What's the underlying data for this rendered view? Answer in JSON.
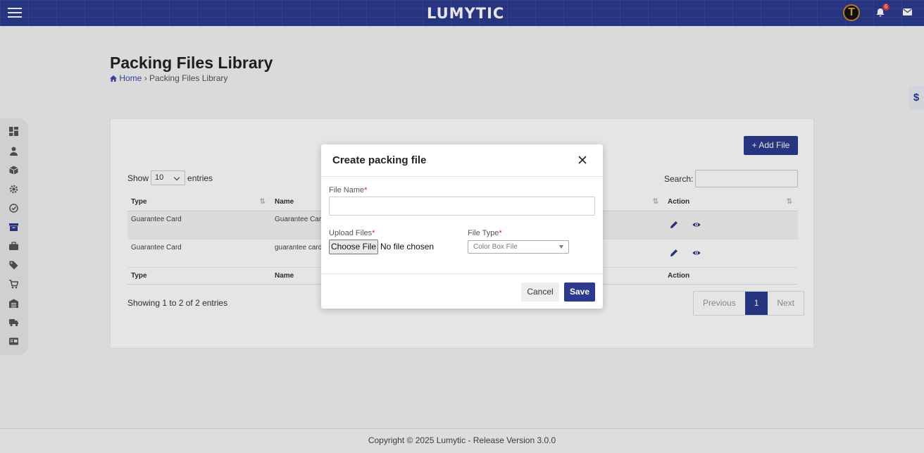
{
  "header": {
    "logo": "LUMYTIC",
    "avatar_letter": "T",
    "notification_count": "6"
  },
  "page": {
    "title": "Packing Files Library",
    "breadcrumb_home": "Home",
    "breadcrumb_sep": "›",
    "breadcrumb_current": "Packing Files Library",
    "side_tab_symbol": "$"
  },
  "toolbar": {
    "add_button": "+ Add File",
    "show_label": "Show",
    "entries_value": "10",
    "entries_label": "entries",
    "search_label": "Search:"
  },
  "table": {
    "columns": [
      "Type",
      "Name",
      "",
      "Action"
    ],
    "rows": [
      {
        "type": "Guarantee Card",
        "name": "Guarantee Card"
      },
      {
        "type": "Guarantee Card",
        "name": "guarantee card"
      }
    ],
    "info": "Showing 1 to 2 of 2 entries",
    "pager": {
      "previous": "Previous",
      "current": "1",
      "next": "Next"
    }
  },
  "footer": {
    "text": "Copyright © 2025 Lumytic - Release Version 3.0.0"
  },
  "modal": {
    "title": "Create packing file",
    "file_name_label": "File Name",
    "upload_label": "Upload Files",
    "choose_file": "Choose File",
    "no_file": "No file chosen",
    "file_type_label": "File Type",
    "file_type_value": "Color Box File",
    "required_mark": "*",
    "cancel": "Cancel",
    "save": "Save"
  },
  "colors": {
    "brand": "#2c3b8f",
    "required": "#c0262d"
  }
}
